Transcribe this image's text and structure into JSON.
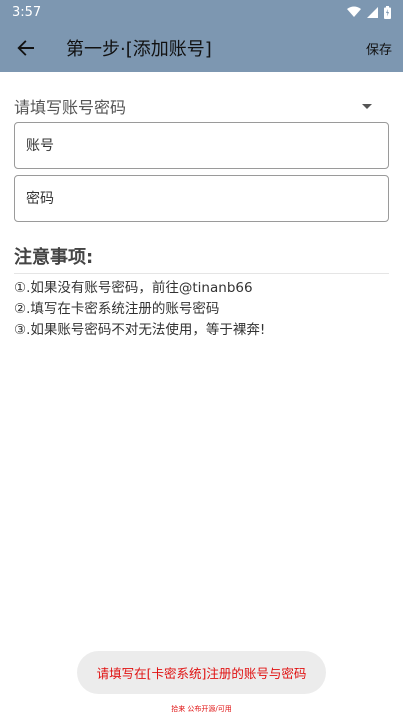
{
  "status_bar": {
    "time": "3:57"
  },
  "app_bar": {
    "title": "第一步·[添加账号]",
    "save_label": "保存"
  },
  "form": {
    "selector_label": "请填写账号密码",
    "account_placeholder": "账号",
    "password_placeholder": "密码"
  },
  "notice": {
    "title": "注意事项:",
    "items": [
      "①.如果没有账号密码，前往@tinanb66",
      "②.填写在卡密系统注册的账号密码",
      "③.如果账号密码不对无法使用，等于裸奔!"
    ]
  },
  "toast": {
    "message": "请填写在[卡密系统]注册的账号与密码"
  },
  "footer": {
    "note": "拾来 公布开源/可用"
  },
  "colors": {
    "app_bar": "#7d97b1",
    "toast_text": "#e01010"
  },
  "icons": {
    "back": "arrow-left",
    "wifi": "wifi",
    "signal": "cell-signal",
    "battery": "battery-charging"
  }
}
